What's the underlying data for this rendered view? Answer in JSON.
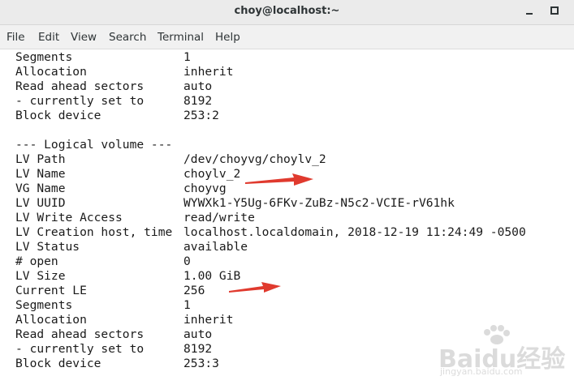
{
  "window": {
    "title": "choy@localhost:~"
  },
  "menubar": {
    "items": [
      "File",
      "Edit",
      "View",
      "Search",
      "Terminal",
      "Help"
    ]
  },
  "terminal": {
    "rows": [
      {
        "k": "Segments",
        "v": "1"
      },
      {
        "k": "Allocation",
        "v": "inherit"
      },
      {
        "k": "Read ahead sectors",
        "v": "auto"
      },
      {
        "k": "- currently set to",
        "v": "8192"
      },
      {
        "k": "Block device",
        "v": "253:2"
      },
      {
        "k": "",
        "v": ""
      },
      {
        "k": "--- Logical volume ---",
        "v": ""
      },
      {
        "k": "LV Path",
        "v": "/dev/choyvg/choylv_2"
      },
      {
        "k": "LV Name",
        "v": "choylv_2"
      },
      {
        "k": "VG Name",
        "v": "choyvg"
      },
      {
        "k": "LV UUID",
        "v": "WYWXk1-Y5Ug-6FKv-ZuBz-N5c2-VCIE-rV61hk"
      },
      {
        "k": "LV Write Access",
        "v": "read/write"
      },
      {
        "k": "LV Creation host, time",
        "v": "localhost.localdomain, 2018-12-19 11:24:49 -0500"
      },
      {
        "k": "LV Status",
        "v": "available"
      },
      {
        "k": "# open",
        "v": "0"
      },
      {
        "k": "LV Size",
        "v": "1.00 GiB"
      },
      {
        "k": "Current LE",
        "v": "256"
      },
      {
        "k": "Segments",
        "v": "1"
      },
      {
        "k": "Allocation",
        "v": "inherit"
      },
      {
        "k": "Read ahead sectors",
        "v": "auto"
      },
      {
        "k": "- currently set to",
        "v": "8192"
      },
      {
        "k": "Block device",
        "v": "253:3"
      }
    ]
  },
  "annotations": {
    "arrow_color": "#e03a2e"
  },
  "watermark": {
    "name": "Baidu经验",
    "sub": "jingyan.baidu.com"
  }
}
